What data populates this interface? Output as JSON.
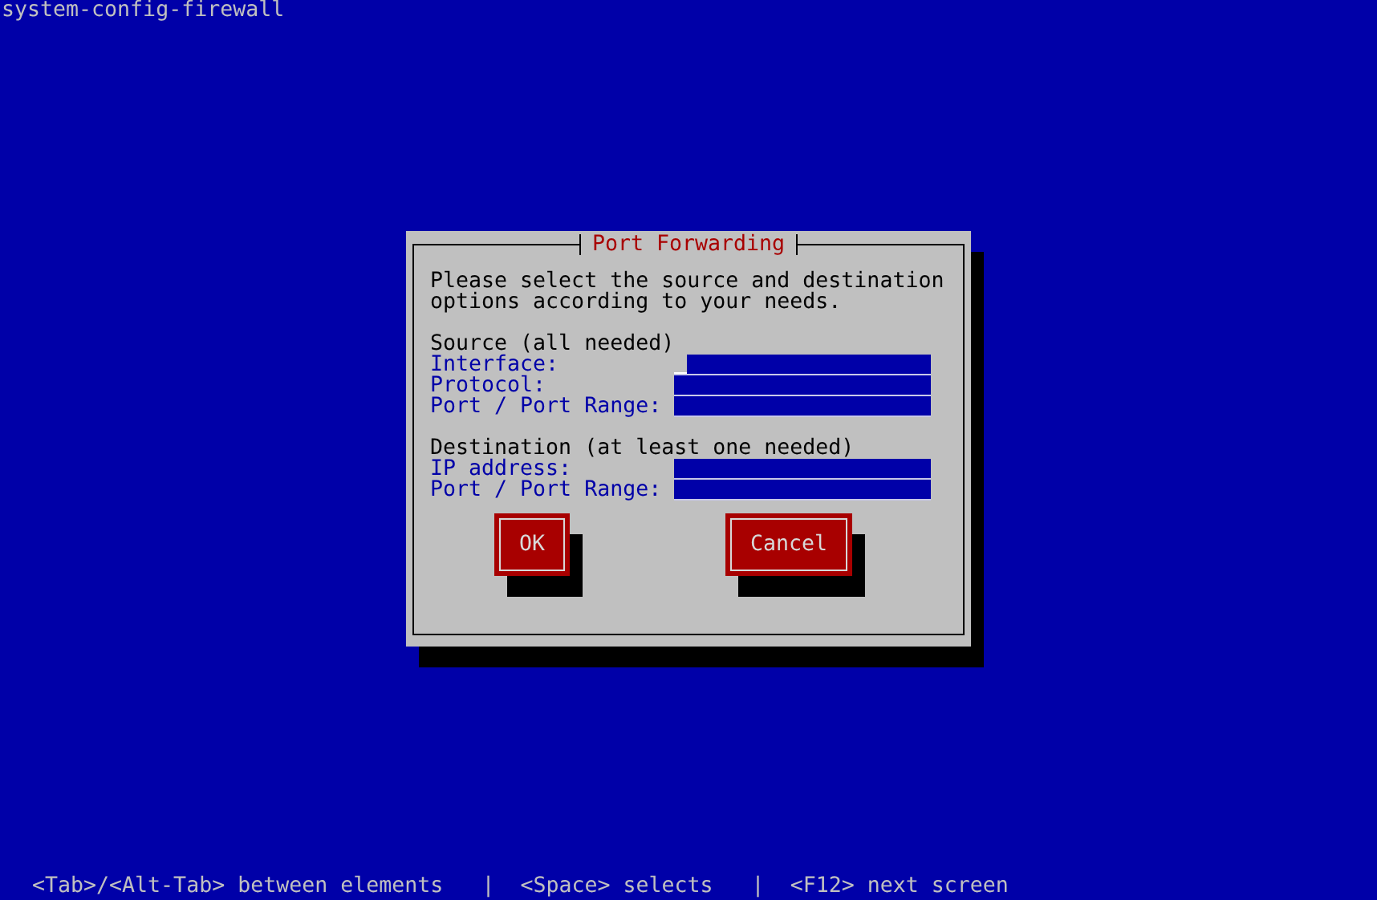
{
  "screen_title": "system-config-firewall",
  "dialog": {
    "title": "Port Forwarding",
    "message": "Please select the source and destination options according to your needs.",
    "sections": [
      {
        "heading": "Source (all needed)",
        "fields": [
          {
            "label": "Interface:",
            "focused": true
          },
          {
            "label": "Protocol:",
            "focused": false
          },
          {
            "label": "Port / Port Range:",
            "focused": false
          }
        ]
      },
      {
        "heading": "Destination (at least one needed)",
        "fields": [
          {
            "label": "IP address:",
            "focused": false
          },
          {
            "label": "Port / Port Range:",
            "focused": false
          }
        ]
      }
    ],
    "buttons": [
      {
        "label": "OK"
      },
      {
        "label": "Cancel"
      }
    ]
  },
  "help_bar": "<Tab>/<Alt-Tab> between elements   |  <Space> selects   |  <F12> next screen"
}
